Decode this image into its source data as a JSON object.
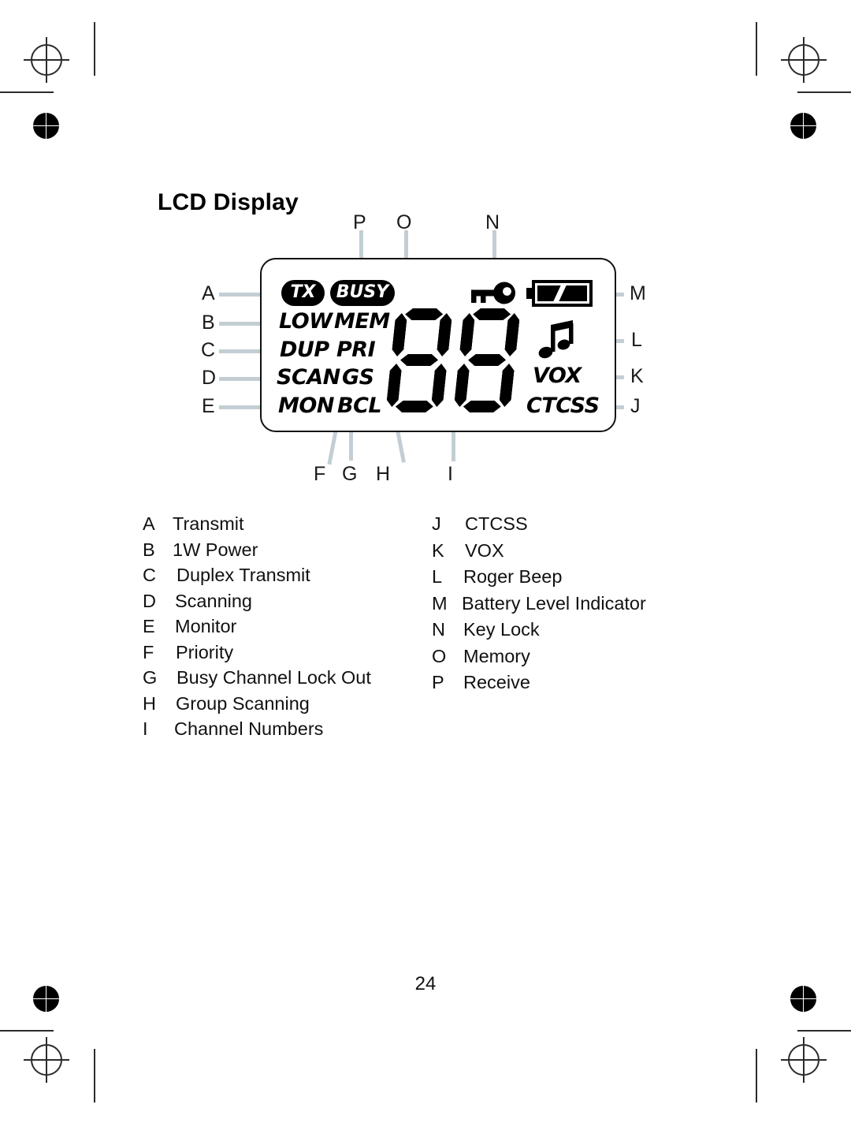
{
  "page": {
    "title": "LCD Display",
    "number": "24"
  },
  "lcd": {
    "indicators": {
      "tx": "TX",
      "busy": "BUSY",
      "low": "LOW",
      "mem": "MEM",
      "dup": "DUP",
      "pri": "PRI",
      "scan": "SCAN",
      "gs": "GS",
      "mon": "MON",
      "bcl": "BCL",
      "vox": "VOX",
      "ctcss": "CTCSS"
    },
    "digits": "88",
    "icons": {
      "key_lock": "key-icon",
      "battery": "battery-icon",
      "roger_beep": "music-note-icon"
    }
  },
  "callouts": {
    "a": "A",
    "b": "B",
    "c": "C",
    "d": "D",
    "e": "E",
    "f": "F",
    "g": "G",
    "h": "H",
    "i": "I",
    "j": "J",
    "k": "K",
    "l": "L",
    "m": "M",
    "n": "N",
    "o": "O",
    "p": "P"
  },
  "legend_left": [
    {
      "key": "A",
      "label": "Transmit"
    },
    {
      "key": "B",
      "label": "1W Power"
    },
    {
      "key": "C",
      "label": "Duplex Transmit"
    },
    {
      "key": "D",
      "label": "Scanning"
    },
    {
      "key": "E",
      "label": "Monitor"
    },
    {
      "key": "F",
      "label": "Priority"
    },
    {
      "key": "G",
      "label": "Busy Channel Lock Out"
    },
    {
      "key": "H",
      "label": "Group Scanning"
    },
    {
      "key": "I",
      "label": "Channel Numbers"
    }
  ],
  "legend_right": [
    {
      "key": "J",
      "label": "CTCSS"
    },
    {
      "key": "K",
      "label": "VOX"
    },
    {
      "key": "L",
      "label": "Roger Beep"
    },
    {
      "key": "M",
      "label": "Battery Level Indicator"
    },
    {
      "key": "N",
      "label": "Key Lock"
    },
    {
      "key": "O",
      "label": "Memory"
    },
    {
      "key": "P",
      "label": "Receive"
    }
  ],
  "colors": {
    "ink": "#000000",
    "leader": "#c3ced4",
    "registration": "#2b2b2b"
  }
}
